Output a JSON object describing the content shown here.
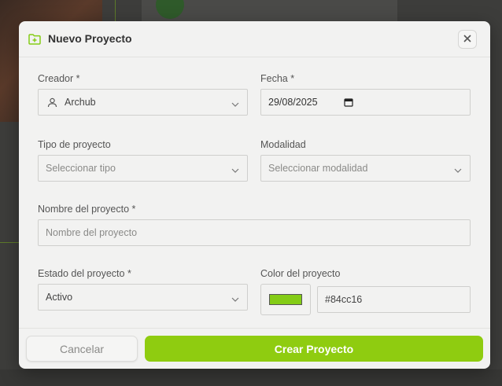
{
  "modal": {
    "title": "Nuevo Proyecto"
  },
  "fields": {
    "creator": {
      "label": "Creador *",
      "value": "Archub"
    },
    "date": {
      "label": "Fecha *",
      "value": "29/08/2025"
    },
    "project_type": {
      "label": "Tipo de proyecto",
      "placeholder": "Seleccionar tipo"
    },
    "modality": {
      "label": "Modalidad",
      "placeholder": "Seleccionar modalidad"
    },
    "project_name": {
      "label": "Nombre del proyecto *",
      "placeholder": "Nombre del proyecto"
    },
    "status": {
      "label": "Estado del proyecto *",
      "value": "Activo"
    },
    "color": {
      "label": "Color del proyecto",
      "value": "#84cc16"
    }
  },
  "footer": {
    "cancel_label": "Cancelar",
    "create_label": "Crear Proyecto"
  },
  "icons": {
    "header": "folder-plus-icon",
    "close": "close-icon",
    "creator": "user-icon",
    "date": "calendar-icon",
    "select": "chevron-down-icon"
  },
  "colors": {
    "accent": "#8fcc10",
    "selected_project_color": "#84cc16"
  }
}
